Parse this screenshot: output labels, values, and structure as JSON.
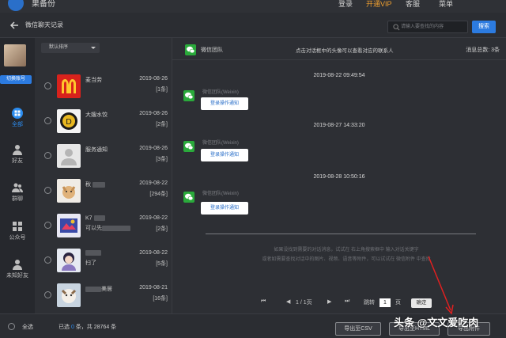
{
  "topbar": {
    "app_name": "果备份",
    "login": "登录",
    "vip": "开通VIP",
    "service": "客服",
    "menu": "菜单"
  },
  "header": {
    "title": "微信聊天记录",
    "search_placeholder": "请输入要查找的内容",
    "search_button": "搜索"
  },
  "leftnav": {
    "switch_account": "切换账号",
    "items": [
      {
        "label": "全部",
        "icon": "grid-icon"
      },
      {
        "label": "好友",
        "icon": "user-icon"
      },
      {
        "label": "群聊",
        "icon": "group-icon"
      },
      {
        "label": "公众号",
        "icon": "apps-icon"
      },
      {
        "label": "未知好友",
        "icon": "unknown-user-icon"
      }
    ]
  },
  "list": {
    "sort_label": "默认排序",
    "contacts": [
      {
        "name": "麦当劳",
        "sub": "",
        "date": "2019-08-26",
        "count": "[1条]"
      },
      {
        "name": "大嫂水饺",
        "sub": "",
        "date": "2019-08-26",
        "count": "[2条]"
      },
      {
        "name": "服务通知",
        "sub": "",
        "date": "2019-08-26",
        "count": "[3条]"
      },
      {
        "name": "秋",
        "sub": "",
        "date": "2019-08-22",
        "count": "[294条]"
      },
      {
        "name": "K7",
        "sub": "可以先",
        "date": "2019-08-22",
        "count": "[2条]"
      },
      {
        "name": "",
        "sub": "扫了",
        "date": "2019-08-22",
        "count": "[5条]"
      },
      {
        "name": "美居",
        "sub": "",
        "date": "2019-08-21",
        "count": "[16条]"
      }
    ]
  },
  "chat": {
    "contact_name": "微信团队",
    "hint": "点击对话框中的头像可以查看对应的联系人",
    "total": "消息总数: 3条",
    "messages": [
      {
        "time": "2019-08-22 09:49:54",
        "sender": "微信团队(Weixin)",
        "text": "登录操作通知"
      },
      {
        "time": "2019-08-27 14:33:20",
        "sender": "微信团队(Weixin)",
        "text": "登录操作通知"
      },
      {
        "time": "2019-08-28 10:50:16",
        "sender": "微信团队(Weixin)",
        "text": "登录操作通知"
      }
    ],
    "note1": "如果没找到需要的对话消息，试试在 右上角搜索框中 输入对话关键字",
    "note2": "或者如需要查找对话中的图片、视频、语音等附件，可以试试在 微信附件 中查找",
    "pager": {
      "page": "1 / 1页",
      "jump_label": "跳转",
      "page_input": "1",
      "page_unit": "页",
      "confirm": "确定"
    }
  },
  "bottom": {
    "select_all": "全选",
    "selected_prefix": "已选",
    "selected_count": "0",
    "selected_suffix": "条，共 28764 条",
    "export_csv": "导出至CSV",
    "export_html": "导出至HTML",
    "export_attach": "导出附件"
  },
  "watermark": "头条 @文文爱吃肉",
  "colors": {
    "accent": "#2c7be0",
    "wechat_green": "#2aaa3b",
    "vip": "#f0a030"
  }
}
